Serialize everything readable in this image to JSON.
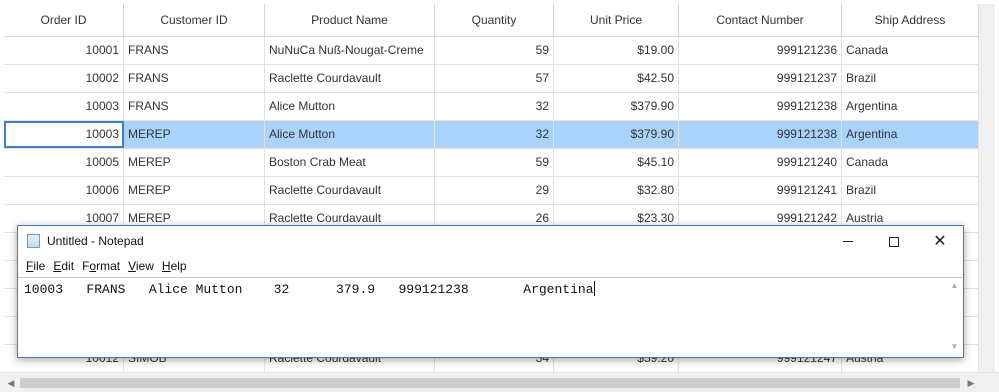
{
  "grid": {
    "columns": [
      "Order ID",
      "Customer ID",
      "Product Name",
      "Quantity",
      "Unit Price",
      "Contact Number",
      "Ship Address"
    ],
    "rows": [
      [
        "10001",
        "FRANS",
        "NuNuCa Nuß-Nougat-Creme",
        "59",
        "$19.00",
        "999121236",
        "Canada"
      ],
      [
        "10002",
        "FRANS",
        "Raclette Courdavault",
        "57",
        "$42.50",
        "999121237",
        "Brazil"
      ],
      [
        "10003",
        "FRANS",
        "Alice Mutton",
        "32",
        "$379.90",
        "999121238",
        "Argentina"
      ],
      [
        "10003",
        "MEREP",
        "Alice Mutton",
        "32",
        "$379.90",
        "999121238",
        "Argentina"
      ],
      [
        "10005",
        "MEREP",
        "Boston Crab Meat",
        "59",
        "$45.10",
        "999121240",
        "Canada"
      ],
      [
        "10006",
        "MEREP",
        "Raclette Courdavault",
        "29",
        "$32.80",
        "999121241",
        "Brazil"
      ],
      [
        "10007",
        "MEREP",
        "Raclette Courdavault",
        "26",
        "$23.30",
        "999121242",
        "Austria"
      ],
      [
        "",
        "",
        "",
        "",
        "",
        "",
        ""
      ],
      [
        "",
        "",
        "",
        "",
        "",
        "",
        ""
      ],
      [
        "",
        "",
        "",
        "",
        "",
        "",
        ""
      ],
      [
        "",
        "",
        "",
        "",
        "",
        "",
        ""
      ],
      [
        "10012",
        "SIMOB",
        "Raclette Courdavault",
        "34",
        "$59.20",
        "999121247",
        "Austria"
      ]
    ],
    "selected_row": 3,
    "current_cell": 0
  },
  "notepad": {
    "title": "Untitled - Notepad",
    "menu": [
      "File",
      "Edit",
      "Format",
      "View",
      "Help"
    ],
    "menu_access_keys": [
      "F",
      "E",
      "o",
      "V",
      "H"
    ],
    "content": "10003   FRANS   Alice Mutton    32      379.9   999121238       Argentina",
    "buttons": {
      "minimize": "minimize-icon",
      "maximize": "maximize-icon",
      "close": "close-icon"
    }
  },
  "colors": {
    "selection": "#a9d3fb",
    "current_cell_border": "#3e7fc6",
    "window_border": "#3d7cc0"
  }
}
